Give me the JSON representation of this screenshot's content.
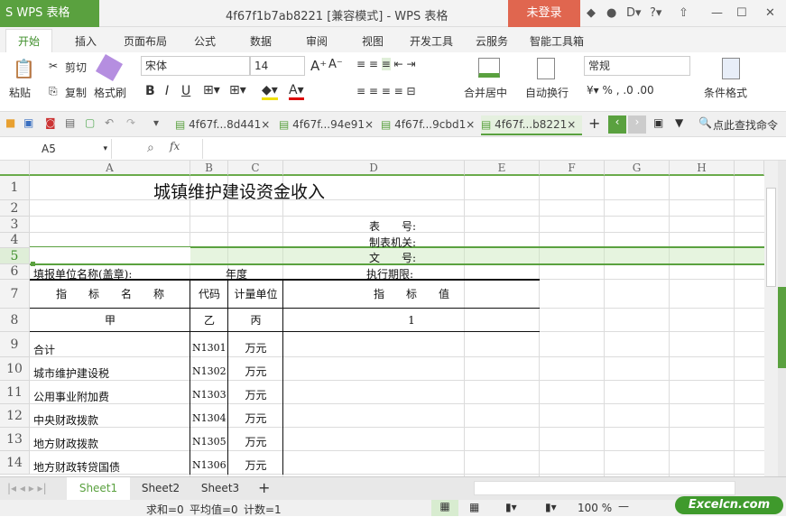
{
  "app": {
    "logo": "S WPS 表格",
    "title": "4f67f1b7ab8221 [兼容模式] - WPS 表格",
    "login": "未登录"
  },
  "menu": [
    "开始",
    "插入",
    "页面布局",
    "公式",
    "数据",
    "审阅",
    "视图",
    "开发工具",
    "云服务",
    "智能工具箱"
  ],
  "ribbon": {
    "paste": "粘贴",
    "cut": "剪切",
    "copy": "复制",
    "format_painter": "格式刷",
    "font": "宋体",
    "size": "14",
    "merge": "合并居中",
    "wrap": "自动换行",
    "number_format": "常规",
    "cond_format": "条件格式",
    "bold": "B",
    "italic": "I",
    "underline": "U"
  },
  "doc_tabs": [
    "4f67f...8d441",
    "4f67f...94e91",
    "4f67f...9cbd1",
    "4f67f...b8221"
  ],
  "search_cmd": "点此查找命令",
  "name_box": "A5",
  "fx": "fx",
  "columns": [
    "A",
    "B",
    "C",
    "D",
    "E",
    "F",
    "G",
    "H"
  ],
  "rows": [
    "1",
    "2",
    "3",
    "4",
    "5",
    "6",
    "7",
    "8",
    "9",
    "10",
    "11",
    "12",
    "13",
    "14"
  ],
  "cells": {
    "title": "城镇维护建设资金收入",
    "r3": "表　　号:",
    "r4": "制表机关:",
    "r5": "文　　号:",
    "r6a": "填报单位名称(盖章):",
    "r6c": "年度",
    "r6d": "执行期限:",
    "h_name": "指　　标　　名　　称",
    "h_code": "代码",
    "h_unit": "计量单位",
    "h_value": "指　　标　　值",
    "s_a": "甲",
    "s_b": "乙",
    "s_c": "丙",
    "s_d": "1",
    "items": [
      {
        "name": "合计",
        "code": "N1301",
        "unit": "万元"
      },
      {
        "name": "城市维护建设税",
        "code": "N1302",
        "unit": "万元"
      },
      {
        "name": "公用事业附加费",
        "code": "N1303",
        "unit": "万元"
      },
      {
        "name": "中央财政拨款",
        "code": "N1304",
        "unit": "万元"
      },
      {
        "name": "地方财政拨款",
        "code": "N1305",
        "unit": "万元"
      },
      {
        "name": "地方财政转贷国债",
        "code": "N1306",
        "unit": "万元"
      }
    ]
  },
  "sheets": [
    "Sheet1",
    "Sheet2",
    "Sheet3"
  ],
  "status": {
    "sum": "求和=0",
    "avg": "平均值=0",
    "count": "计数=1",
    "zoom": "100 %"
  },
  "watermark": "Excelcn.com"
}
